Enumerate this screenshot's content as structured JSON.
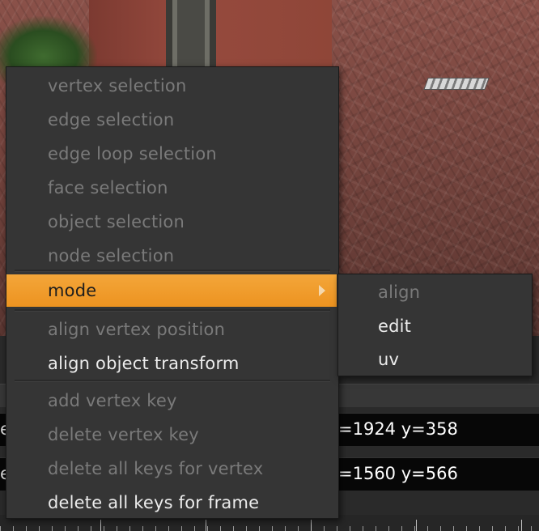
{
  "context_menu": {
    "items": [
      {
        "label": "vertex selection",
        "enabled": false
      },
      {
        "label": "edge selection",
        "enabled": false
      },
      {
        "label": "edge loop selection",
        "enabled": false
      },
      {
        "label": "face selection",
        "enabled": false
      },
      {
        "label": "object selection",
        "enabled": false
      },
      {
        "label": "node selection",
        "enabled": false
      },
      {
        "label": "mode",
        "enabled": true,
        "highlighted": true,
        "has_submenu": true
      },
      {
        "label": "align vertex position",
        "enabled": false
      },
      {
        "label": "align object transform",
        "enabled": true
      },
      {
        "label": "add vertex key",
        "enabled": false
      },
      {
        "label": "delete vertex key",
        "enabled": false
      },
      {
        "label": "delete all keys for vertex",
        "enabled": false
      },
      {
        "label": "delete all keys for frame",
        "enabled": true
      }
    ]
  },
  "submenu": {
    "items": [
      {
        "label": "align",
        "enabled": false
      },
      {
        "label": "edit",
        "enabled": true
      },
      {
        "label": "uv",
        "enabled": true
      }
    ]
  },
  "coords": {
    "row1": {
      "prefix": "e",
      "text": "=1924 y=358"
    },
    "row2": {
      "prefix": "e",
      "text": "=1560 y=566"
    }
  },
  "colors": {
    "highlight": "#f09a28",
    "menu_bg": "#353535",
    "enabled_text": "#ececec",
    "disabled_text": "#7a7a7a"
  }
}
